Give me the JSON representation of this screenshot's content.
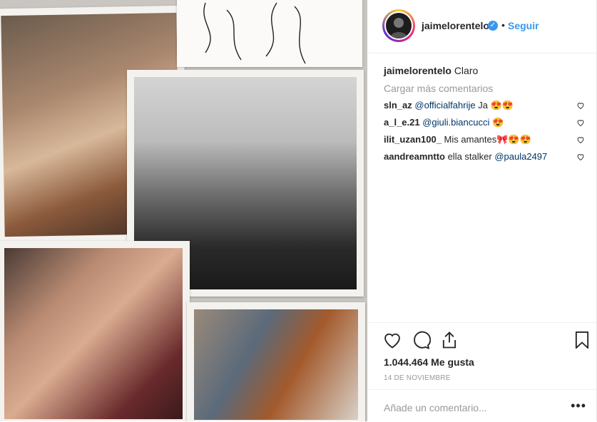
{
  "header": {
    "username": "jaimelorentelo",
    "verified_mark": "✓",
    "separator": "•",
    "follow_label": "Seguir"
  },
  "caption": {
    "username": "jaimelorentelo",
    "text": "Claro"
  },
  "load_more_label": "Cargar más comentarios",
  "comments": [
    {
      "user": "sln_az",
      "mention": "@officialfahrije",
      "text": " Ja 😍😍"
    },
    {
      "user": "a_l_e.21",
      "mention": "@giuli.biancucci",
      "text": " 😍"
    },
    {
      "user": "ilit_uzan100_",
      "mention": "",
      "text": " Mis amantes🎀😍😍"
    },
    {
      "user": "aandreamntto",
      "mention": "",
      "text": " ella stalker ",
      "mention_after": "@paula2497"
    }
  ],
  "likes_label": "1.044.464 Me gusta",
  "date_label": "14 DE NOVIEMBRE",
  "add_comment_placeholder": "Añade un comentario...",
  "more_options": "•••",
  "icons": {
    "like": "heart-icon",
    "comment": "comment-icon",
    "share": "share-icon",
    "save": "bookmark-icon",
    "comment_like": "heart-icon",
    "verified": "verified-badge-icon"
  },
  "colors": {
    "accent": "#3897f0",
    "text": "#262626",
    "muted": "#999999",
    "divider": "#efefef"
  }
}
